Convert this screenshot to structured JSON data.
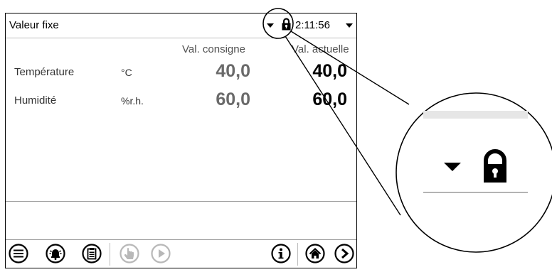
{
  "window": {
    "title": "Valeur fixe",
    "time": "2:11:56"
  },
  "table": {
    "col_setpoint": "Val. consigne",
    "col_actual": "Val. actuelle",
    "rows": [
      {
        "label": "Température",
        "unit": "°C",
        "setpoint": "40,0",
        "actual": "40,0"
      },
      {
        "label": "Humidité",
        "unit": "%r.h.",
        "setpoint": "60,0",
        "actual": "60,0"
      }
    ]
  },
  "toolbar": {
    "icons": [
      "menu-list-icon",
      "alarm-bell-icon",
      "clipboard-icon",
      "touch-hand-icon",
      "play-icon",
      "info-icon",
      "home-icon",
      "next-arrow-icon"
    ]
  },
  "colors": {
    "setpoint_text": "#6a6a6a",
    "actual_text": "#000000",
    "disabled_icon": "#b8b8b8"
  }
}
